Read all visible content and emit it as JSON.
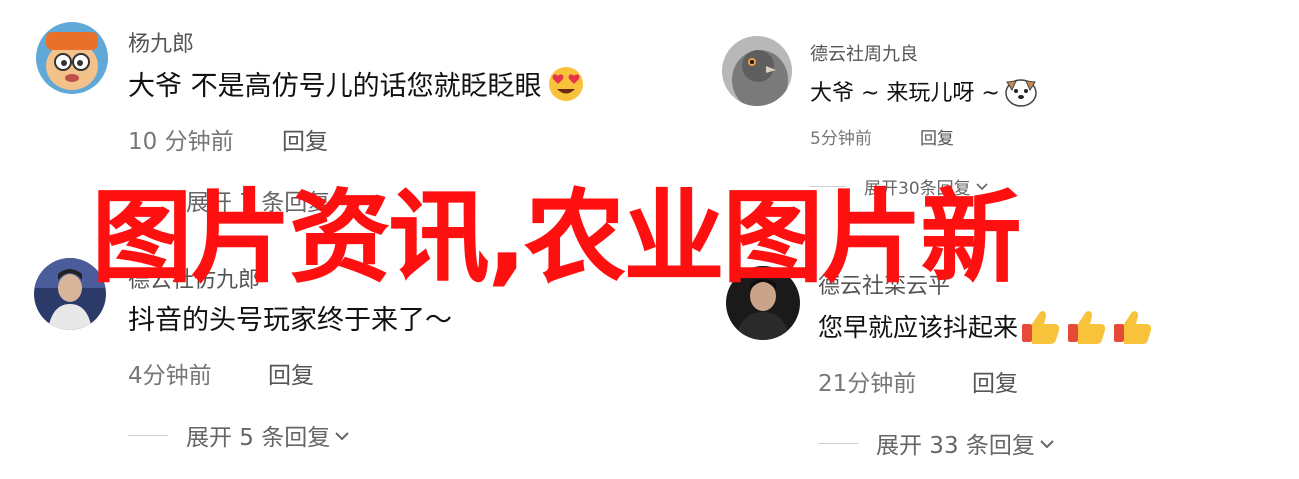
{
  "watermark": "图片资讯,农业图片新",
  "comments": [
    {
      "username": "杨九郎",
      "text": "大爷 不是高仿号儿的话您就眨眨眼",
      "emoji": "heart-eyes-emoji",
      "time": "10 分钟前",
      "reply": "回复",
      "expand": "展开 7 条回复",
      "avatar": "cartoon-avatar"
    },
    {
      "username": "德云社周九良",
      "text": "大爷 ~ 来玩儿呀 ~",
      "emoji": "dog-face-emoji",
      "time": "5分钟前",
      "reply": "回复",
      "expand": "展开30条回复",
      "avatar": "pigeon-avatar"
    },
    {
      "username": "德云社仿九郎",
      "text": "抖音的头号玩家终于来了～",
      "time": "4分钟前",
      "reply": "回复",
      "expand": "展开 5 条回复",
      "avatar": "person-avatar"
    },
    {
      "username": "德云社栾云平",
      "text": "您早就应该抖起来",
      "emoji": "thumbs-up-emoji",
      "time": "21分钟前",
      "reply": "回复",
      "expand": "展开 33 条回复",
      "avatar": "person-dark-avatar"
    }
  ],
  "colors": {
    "watermark": "#ff1010",
    "text": "#111111",
    "meta": "#777777"
  }
}
